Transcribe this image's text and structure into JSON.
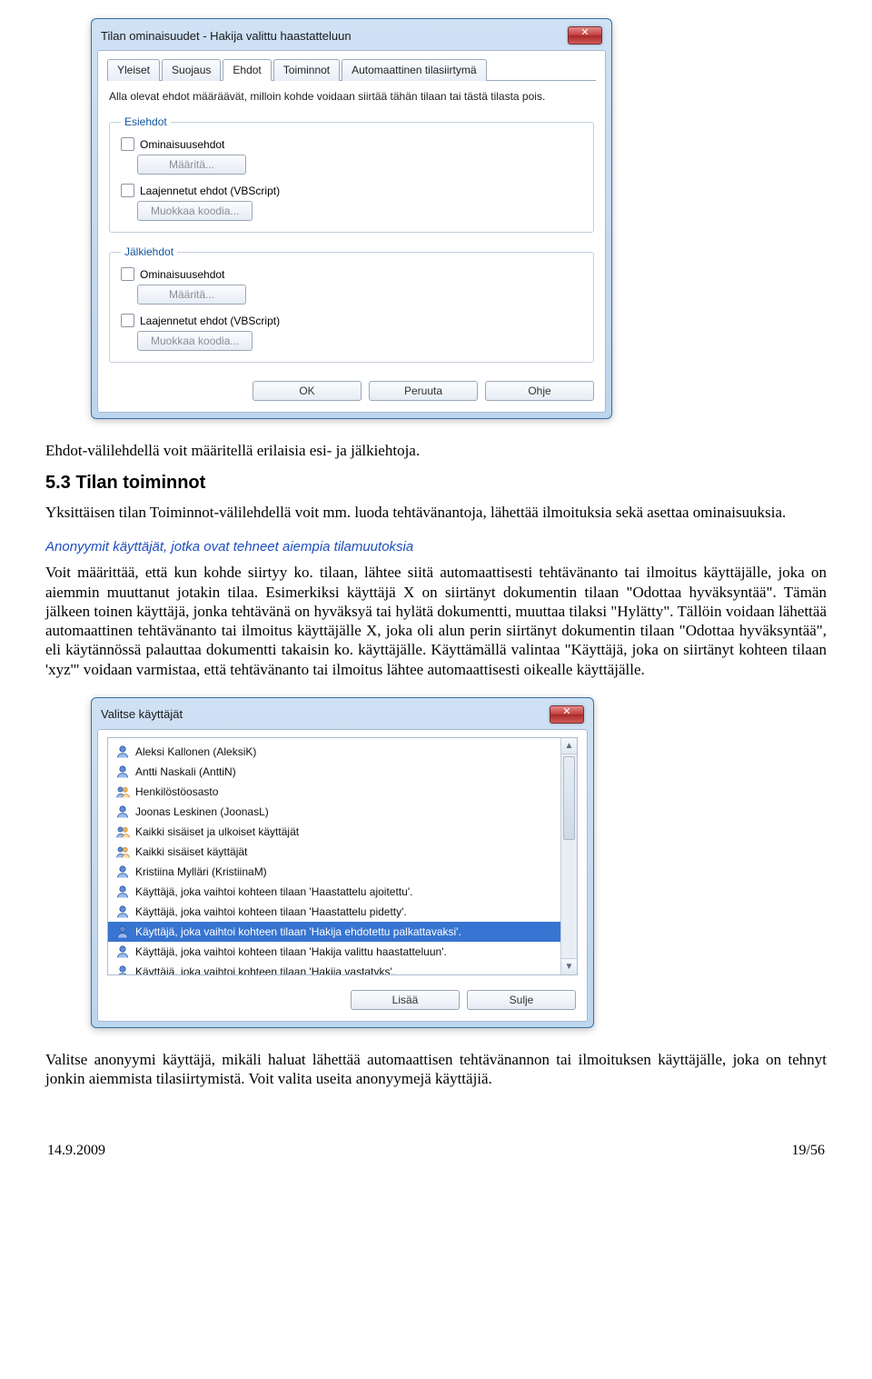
{
  "dialog1": {
    "title": "Tilan ominaisuudet - Hakija valittu haastatteluun",
    "tabs": [
      "Yleiset",
      "Suojaus",
      "Ehdot",
      "Toiminnot",
      "Automaattinen tilasiirtymä"
    ],
    "active_tab_index": 2,
    "intro": "Alla olevat ehdot määräävät, milloin kohde voidaan siirtää tähän tilaan tai tästä tilasta pois.",
    "pre": {
      "legend": "Esiehdot",
      "chk1": "Ominaisuusehdot",
      "btn1": "Määritä...",
      "chk2": "Laajennetut ehdot (VBScript)",
      "btn2": "Muokkaa koodia..."
    },
    "post": {
      "legend": "Jälkiehdot",
      "chk1": "Ominaisuusehdot",
      "btn1": "Määritä...",
      "chk2": "Laajennetut ehdot (VBScript)",
      "btn2": "Muokkaa koodia..."
    },
    "ok": "OK",
    "cancel": "Peruuta",
    "help": "Ohje"
  },
  "document": {
    "after_dlg1_p1": "Ehdot-välilehdellä voit määritellä erilaisia esi- ja jälkiehtoja.",
    "section_heading": "5.3  Tilan toiminnot",
    "p2": "Yksittäisen tilan Toiminnot-välilehdellä voit mm. luoda tehtävänantoja, lähettää ilmoituksia sekä asettaa ominaisuuksia.",
    "blue_italic": "Anonyymit käyttäjät, jotka ovat tehneet aiempia tilamuutoksia",
    "p3": "Voit määrittää, että kun kohde siirtyy ko. tilaan, lähtee siitä automaattisesti tehtävänanto tai ilmoitus käyttäjälle, joka on aiemmin muuttanut jotakin tilaa. Esimerkiksi käyttäjä X on siirtänyt dokumentin tilaan \"Odottaa hyväksyntää\". Tämän jälkeen toinen käyttäjä, jonka tehtävänä on hyväksyä tai hylätä dokumentti, muuttaa tilaksi \"Hylätty\". Tällöin voidaan lähettää automaattinen tehtävänanto tai ilmoitus käyttäjälle X, joka oli alun perin siirtänyt dokumentin tilaan \"Odottaa hyväksyntää\", eli käytännössä palauttaa dokumentti takaisin ko. käyttäjälle. Käyttämällä valintaa \"Käyttäjä, joka on siirtänyt kohteen tilaan 'xyz'\" voidaan varmistaa, että tehtävänanto tai ilmoitus lähtee automaattisesti oikealle käyttäjälle.",
    "p4": "Valitse anonyymi käyttäjä, mikäli haluat lähettää automaattisen tehtävänannon tai ilmoituksen käyttäjälle, joka on tehnyt jonkin aiemmista tilasiirtymistä. Voit valita useita anonyymejä käyttäjiä.",
    "footer_date": "14.9.2009",
    "footer_page": "19/56"
  },
  "dialog2": {
    "title": "Valitse käyttäjät",
    "items": [
      {
        "icon": "user",
        "label": "Aleksi Kallonen (AleksiK)"
      },
      {
        "icon": "user",
        "label": "Antti Naskali (AnttiN)"
      },
      {
        "icon": "users",
        "label": "Henkilöstöosasto"
      },
      {
        "icon": "user",
        "label": "Joonas Leskinen (JoonasL)"
      },
      {
        "icon": "users",
        "label": "Kaikki sisäiset ja ulkoiset käyttäjät"
      },
      {
        "icon": "users",
        "label": "Kaikki sisäiset käyttäjät"
      },
      {
        "icon": "user",
        "label": "Kristiina Mylläri (KristiinaM)"
      },
      {
        "icon": "user",
        "label": "Käyttäjä, joka vaihtoi kohteen tilaan 'Haastattelu ajoitettu'."
      },
      {
        "icon": "user",
        "label": "Käyttäjä, joka vaihtoi kohteen tilaan 'Haastattelu pidetty'."
      },
      {
        "icon": "user",
        "label": "Käyttäjä, joka vaihtoi kohteen tilaan 'Hakija ehdotettu palkattavaksi'.",
        "selected": true
      },
      {
        "icon": "user",
        "label": "Käyttäjä, joka vaihtoi kohteen tilaan 'Hakija valittu haastatteluun'."
      },
      {
        "icon": "user",
        "label": "Käyttäjä, joka vaihtoi kohteen tilaan 'Hakija vastatyks'."
      }
    ],
    "add": "Lisää",
    "close": "Sulje"
  }
}
